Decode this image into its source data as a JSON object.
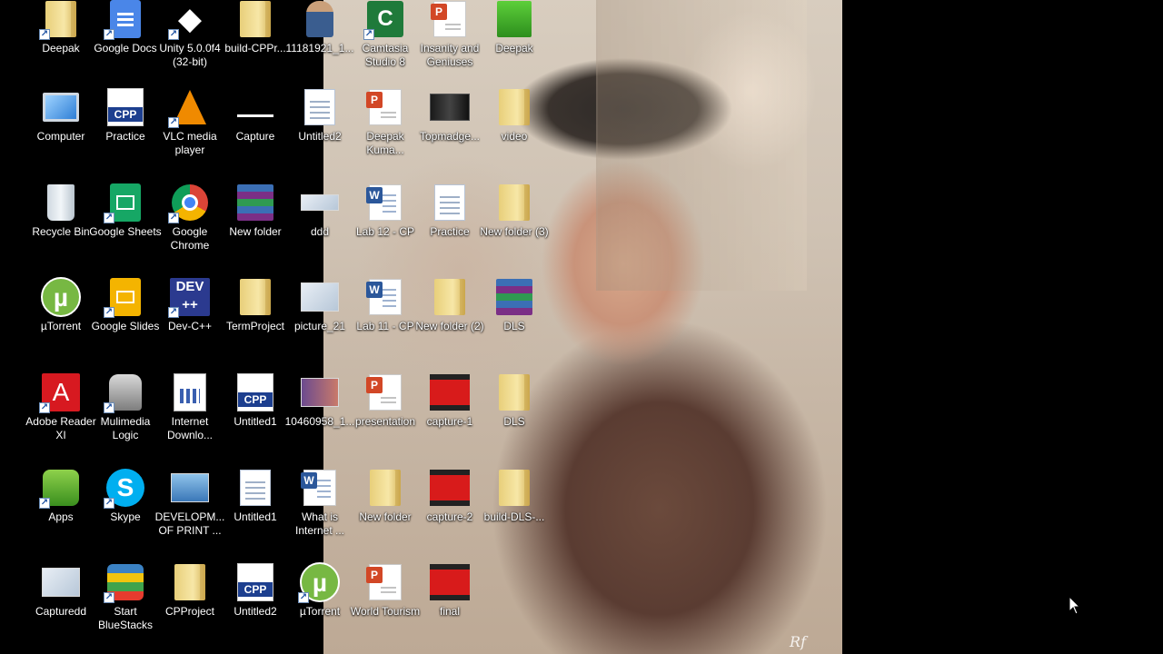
{
  "desktop": {
    "wallpaper_signature": "Rf",
    "icons": [
      {
        "label": "Deepak",
        "icon": "user-folder-icon"
      },
      {
        "label": "Google Docs",
        "icon": "google-docs-icon"
      },
      {
        "label": "Unity 5.0.0f4 (32-bit)",
        "icon": "unity-icon"
      },
      {
        "label": "build-CPPr...",
        "icon": "folder-icon"
      },
      {
        "label": "11181921_1...",
        "icon": "photo-icon"
      },
      {
        "label": "Camtasia Studio 8",
        "icon": "camtasia-icon"
      },
      {
        "label": "Insanity and Geniuses",
        "icon": "powerpoint-icon"
      },
      {
        "label": "Deepak",
        "icon": "green-image-icon"
      },
      {
        "label": "Computer",
        "icon": "computer-icon"
      },
      {
        "label": "Practice",
        "icon": "cpp-file-icon"
      },
      {
        "label": "VLC media player",
        "icon": "vlc-icon"
      },
      {
        "label": "Capture",
        "icon": "image-icon"
      },
      {
        "label": "Untitled2",
        "icon": "image-icon"
      },
      {
        "label": "Deepak Kuma...",
        "icon": "powerpoint-icon"
      },
      {
        "label": "Topmadge...",
        "icon": "video-thumbnail-icon"
      },
      {
        "label": "video",
        "icon": "folder-icon"
      },
      {
        "label": "Recycle Bin",
        "icon": "recycle-bin-icon"
      },
      {
        "label": "Google Sheets",
        "icon": "google-sheets-icon"
      },
      {
        "label": "Google Chrome",
        "icon": "chrome-icon"
      },
      {
        "label": "New folder",
        "icon": "winrar-icon"
      },
      {
        "label": "ddd",
        "icon": "image-icon"
      },
      {
        "label": "Lab 12 - CP",
        "icon": "word-icon"
      },
      {
        "label": "Practice",
        "icon": "image-icon"
      },
      {
        "label": "New folder (3)",
        "icon": "folder-icon"
      },
      {
        "label": "µTorrent",
        "icon": "utorrent-icon"
      },
      {
        "label": "Google Slides",
        "icon": "google-slides-icon"
      },
      {
        "label": "Dev-C++",
        "icon": "dev-cpp-icon"
      },
      {
        "label": "TermProject",
        "icon": "folder-icon"
      },
      {
        "label": "picture_21",
        "icon": "image-icon"
      },
      {
        "label": "Lab 11 - CP",
        "icon": "word-icon"
      },
      {
        "label": "New folder (2)",
        "icon": "folder-icon"
      },
      {
        "label": "DLS",
        "icon": "winrar-icon"
      },
      {
        "label": "Adobe Reader XI",
        "icon": "adobe-reader-icon"
      },
      {
        "label": "Mulimedia Logic",
        "icon": "mulimedia-logic-icon"
      },
      {
        "label": "Internet Downlo...",
        "icon": "internet-download-icon"
      },
      {
        "label": "Untitled1",
        "icon": "cpp-file-icon"
      },
      {
        "label": "10460958_1...",
        "icon": "photo-icon"
      },
      {
        "label": "presentation",
        "icon": "powerpoint-icon"
      },
      {
        "label": "capture-1",
        "icon": "video-icon"
      },
      {
        "label": "DLS",
        "icon": "folder-icon"
      },
      {
        "label": "Apps",
        "icon": "apps-icon"
      },
      {
        "label": "Skype",
        "icon": "skype-icon"
      },
      {
        "label": "DEVELOPM... OF PRINT ...",
        "icon": "image-icon"
      },
      {
        "label": "Untitled1",
        "icon": "image-icon"
      },
      {
        "label": "What is Internet ...",
        "icon": "word-icon"
      },
      {
        "label": "New folder",
        "icon": "folder-icon"
      },
      {
        "label": "capture-2",
        "icon": "video-icon"
      },
      {
        "label": "build-DLS-...",
        "icon": "folder-icon"
      },
      {
        "label": "Capturedd",
        "icon": "image-icon"
      },
      {
        "label": "Start BlueStacks",
        "icon": "bluestacks-icon"
      },
      {
        "label": "CPProject",
        "icon": "folder-icon"
      },
      {
        "label": "Untitled2",
        "icon": "cpp-file-icon"
      },
      {
        "label": "µTorrent",
        "icon": "utorrent-icon"
      },
      {
        "label": "World Tourism",
        "icon": "powerpoint-icon"
      },
      {
        "label": "final",
        "icon": "video-icon"
      }
    ]
  }
}
